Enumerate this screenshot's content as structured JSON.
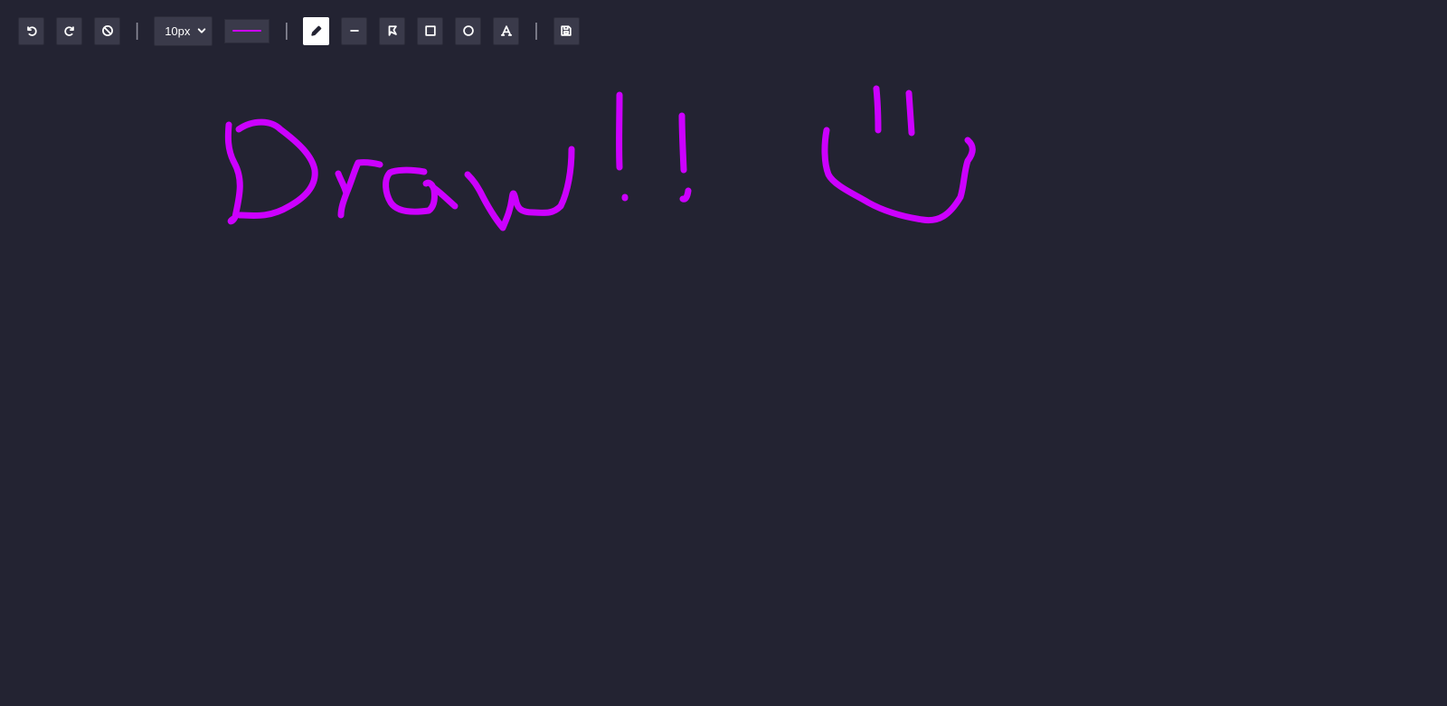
{
  "toolbar": {
    "undo_icon": "undo-icon",
    "redo_icon": "redo-icon",
    "clear_icon": "ban-icon",
    "separator": "|",
    "brush_size": "10px",
    "brush_size_icon": "chevron-down-icon",
    "stroke_color": "#cc00ff",
    "pen_icon": "pencil-icon",
    "line_icon": "minus-icon",
    "polygon_icon": "polygon-icon",
    "rectangle_icon": "square-icon",
    "ellipse_icon": "circle-icon",
    "text_icon": "text-a-icon",
    "save_icon": "floppy-disk-icon",
    "active_tool": "pen"
  },
  "canvas": {
    "background": "#232332",
    "stroke_color": "#cc00ff"
  }
}
